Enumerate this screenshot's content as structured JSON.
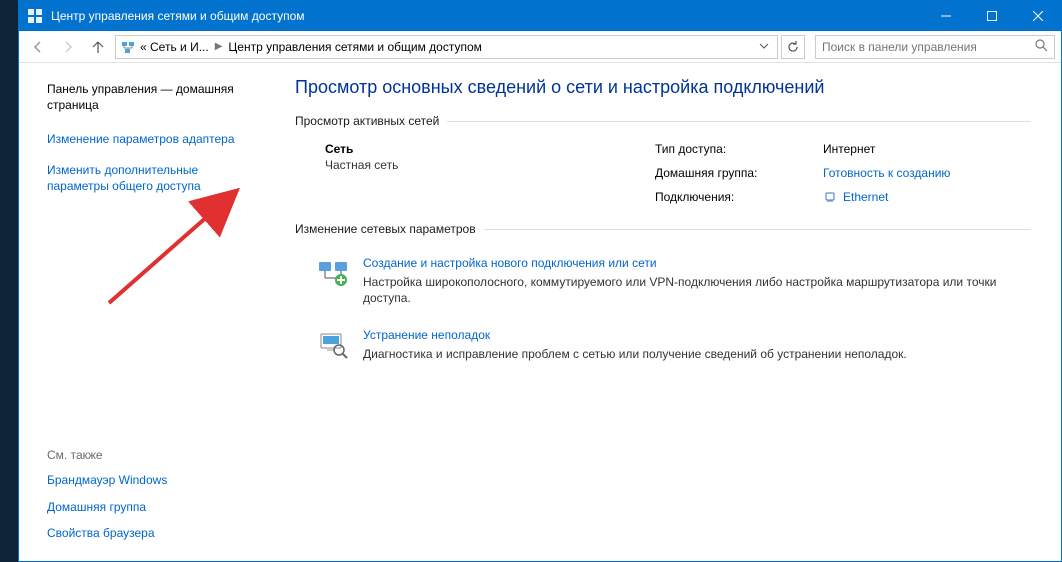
{
  "titlebar": {
    "title": "Центр управления сетями и общим доступом"
  },
  "address": {
    "crumb1": "« Сеть и И...",
    "crumb2": "Центр управления сетями и общим доступом"
  },
  "search": {
    "placeholder": "Поиск в панели управления"
  },
  "sidebar": {
    "home": "Панель управления — домашняя страница",
    "link1": "Изменение параметров адаптера",
    "link2": "Изменить дополнительные параметры общего доступа",
    "seealso_label": "См. также",
    "see1": "Брандмауэр Windows",
    "see2": "Домашняя группа",
    "see3": "Свойства браузера"
  },
  "main": {
    "heading": "Просмотр основных сведений о сети и настройка подключений",
    "active_title": "Просмотр активных сетей",
    "network": {
      "name": "Сеть",
      "type": "Частная сеть",
      "access_label": "Тип доступа:",
      "access_value": "Интернет",
      "homegroup_label": "Домашняя группа:",
      "homegroup_value": "Готовность к созданию",
      "conn_label": "Подключения:",
      "conn_value": "Ethernet"
    },
    "settings_title": "Изменение сетевых параметров",
    "task1": {
      "title": "Создание и настройка нового подключения или сети",
      "desc": "Настройка широкополосного, коммутируемого или VPN-подключения либо настройка маршрутизатора или точки доступа."
    },
    "task2": {
      "title": "Устранение неполадок",
      "desc": "Диагностика и исправление проблем с сетью или получение сведений об устранении неполадок."
    }
  }
}
